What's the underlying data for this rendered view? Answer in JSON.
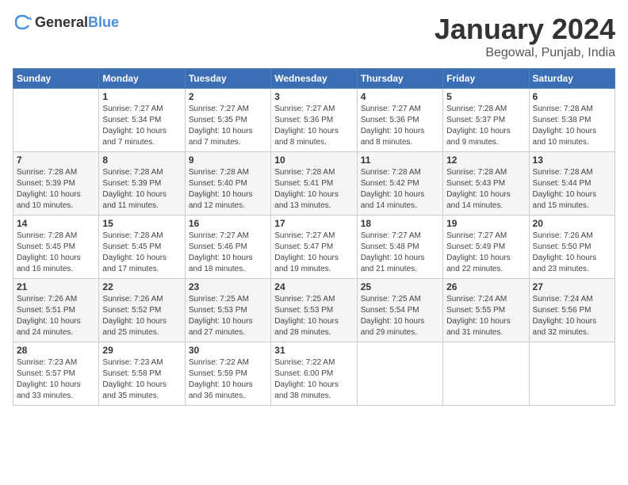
{
  "header": {
    "logo_general": "General",
    "logo_blue": "Blue",
    "title": "January 2024",
    "location": "Begowal, Punjab, India"
  },
  "weekdays": [
    "Sunday",
    "Monday",
    "Tuesday",
    "Wednesday",
    "Thursday",
    "Friday",
    "Saturday"
  ],
  "weeks": [
    [
      {
        "day": "",
        "sunrise": "",
        "sunset": "",
        "daylight": ""
      },
      {
        "day": "1",
        "sunrise": "Sunrise: 7:27 AM",
        "sunset": "Sunset: 5:34 PM",
        "daylight": "Daylight: 10 hours and 7 minutes."
      },
      {
        "day": "2",
        "sunrise": "Sunrise: 7:27 AM",
        "sunset": "Sunset: 5:35 PM",
        "daylight": "Daylight: 10 hours and 7 minutes."
      },
      {
        "day": "3",
        "sunrise": "Sunrise: 7:27 AM",
        "sunset": "Sunset: 5:36 PM",
        "daylight": "Daylight: 10 hours and 8 minutes."
      },
      {
        "day": "4",
        "sunrise": "Sunrise: 7:27 AM",
        "sunset": "Sunset: 5:36 PM",
        "daylight": "Daylight: 10 hours and 8 minutes."
      },
      {
        "day": "5",
        "sunrise": "Sunrise: 7:28 AM",
        "sunset": "Sunset: 5:37 PM",
        "daylight": "Daylight: 10 hours and 9 minutes."
      },
      {
        "day": "6",
        "sunrise": "Sunrise: 7:28 AM",
        "sunset": "Sunset: 5:38 PM",
        "daylight": "Daylight: 10 hours and 10 minutes."
      }
    ],
    [
      {
        "day": "7",
        "sunrise": "Sunrise: 7:28 AM",
        "sunset": "Sunset: 5:39 PM",
        "daylight": "Daylight: 10 hours and 10 minutes."
      },
      {
        "day": "8",
        "sunrise": "Sunrise: 7:28 AM",
        "sunset": "Sunset: 5:39 PM",
        "daylight": "Daylight: 10 hours and 11 minutes."
      },
      {
        "day": "9",
        "sunrise": "Sunrise: 7:28 AM",
        "sunset": "Sunset: 5:40 PM",
        "daylight": "Daylight: 10 hours and 12 minutes."
      },
      {
        "day": "10",
        "sunrise": "Sunrise: 7:28 AM",
        "sunset": "Sunset: 5:41 PM",
        "daylight": "Daylight: 10 hours and 13 minutes."
      },
      {
        "day": "11",
        "sunrise": "Sunrise: 7:28 AM",
        "sunset": "Sunset: 5:42 PM",
        "daylight": "Daylight: 10 hours and 14 minutes."
      },
      {
        "day": "12",
        "sunrise": "Sunrise: 7:28 AM",
        "sunset": "Sunset: 5:43 PM",
        "daylight": "Daylight: 10 hours and 14 minutes."
      },
      {
        "day": "13",
        "sunrise": "Sunrise: 7:28 AM",
        "sunset": "Sunset: 5:44 PM",
        "daylight": "Daylight: 10 hours and 15 minutes."
      }
    ],
    [
      {
        "day": "14",
        "sunrise": "Sunrise: 7:28 AM",
        "sunset": "Sunset: 5:45 PM",
        "daylight": "Daylight: 10 hours and 16 minutes."
      },
      {
        "day": "15",
        "sunrise": "Sunrise: 7:28 AM",
        "sunset": "Sunset: 5:45 PM",
        "daylight": "Daylight: 10 hours and 17 minutes."
      },
      {
        "day": "16",
        "sunrise": "Sunrise: 7:27 AM",
        "sunset": "Sunset: 5:46 PM",
        "daylight": "Daylight: 10 hours and 18 minutes."
      },
      {
        "day": "17",
        "sunrise": "Sunrise: 7:27 AM",
        "sunset": "Sunset: 5:47 PM",
        "daylight": "Daylight: 10 hours and 19 minutes."
      },
      {
        "day": "18",
        "sunrise": "Sunrise: 7:27 AM",
        "sunset": "Sunset: 5:48 PM",
        "daylight": "Daylight: 10 hours and 21 minutes."
      },
      {
        "day": "19",
        "sunrise": "Sunrise: 7:27 AM",
        "sunset": "Sunset: 5:49 PM",
        "daylight": "Daylight: 10 hours and 22 minutes."
      },
      {
        "day": "20",
        "sunrise": "Sunrise: 7:26 AM",
        "sunset": "Sunset: 5:50 PM",
        "daylight": "Daylight: 10 hours and 23 minutes."
      }
    ],
    [
      {
        "day": "21",
        "sunrise": "Sunrise: 7:26 AM",
        "sunset": "Sunset: 5:51 PM",
        "daylight": "Daylight: 10 hours and 24 minutes."
      },
      {
        "day": "22",
        "sunrise": "Sunrise: 7:26 AM",
        "sunset": "Sunset: 5:52 PM",
        "daylight": "Daylight: 10 hours and 25 minutes."
      },
      {
        "day": "23",
        "sunrise": "Sunrise: 7:25 AM",
        "sunset": "Sunset: 5:53 PM",
        "daylight": "Daylight: 10 hours and 27 minutes."
      },
      {
        "day": "24",
        "sunrise": "Sunrise: 7:25 AM",
        "sunset": "Sunset: 5:53 PM",
        "daylight": "Daylight: 10 hours and 28 minutes."
      },
      {
        "day": "25",
        "sunrise": "Sunrise: 7:25 AM",
        "sunset": "Sunset: 5:54 PM",
        "daylight": "Daylight: 10 hours and 29 minutes."
      },
      {
        "day": "26",
        "sunrise": "Sunrise: 7:24 AM",
        "sunset": "Sunset: 5:55 PM",
        "daylight": "Daylight: 10 hours and 31 minutes."
      },
      {
        "day": "27",
        "sunrise": "Sunrise: 7:24 AM",
        "sunset": "Sunset: 5:56 PM",
        "daylight": "Daylight: 10 hours and 32 minutes."
      }
    ],
    [
      {
        "day": "28",
        "sunrise": "Sunrise: 7:23 AM",
        "sunset": "Sunset: 5:57 PM",
        "daylight": "Daylight: 10 hours and 33 minutes."
      },
      {
        "day": "29",
        "sunrise": "Sunrise: 7:23 AM",
        "sunset": "Sunset: 5:58 PM",
        "daylight": "Daylight: 10 hours and 35 minutes."
      },
      {
        "day": "30",
        "sunrise": "Sunrise: 7:22 AM",
        "sunset": "Sunset: 5:59 PM",
        "daylight": "Daylight: 10 hours and 36 minutes."
      },
      {
        "day": "31",
        "sunrise": "Sunrise: 7:22 AM",
        "sunset": "Sunset: 6:00 PM",
        "daylight": "Daylight: 10 hours and 38 minutes."
      },
      {
        "day": "",
        "sunrise": "",
        "sunset": "",
        "daylight": ""
      },
      {
        "day": "",
        "sunrise": "",
        "sunset": "",
        "daylight": ""
      },
      {
        "day": "",
        "sunrise": "",
        "sunset": "",
        "daylight": ""
      }
    ]
  ]
}
